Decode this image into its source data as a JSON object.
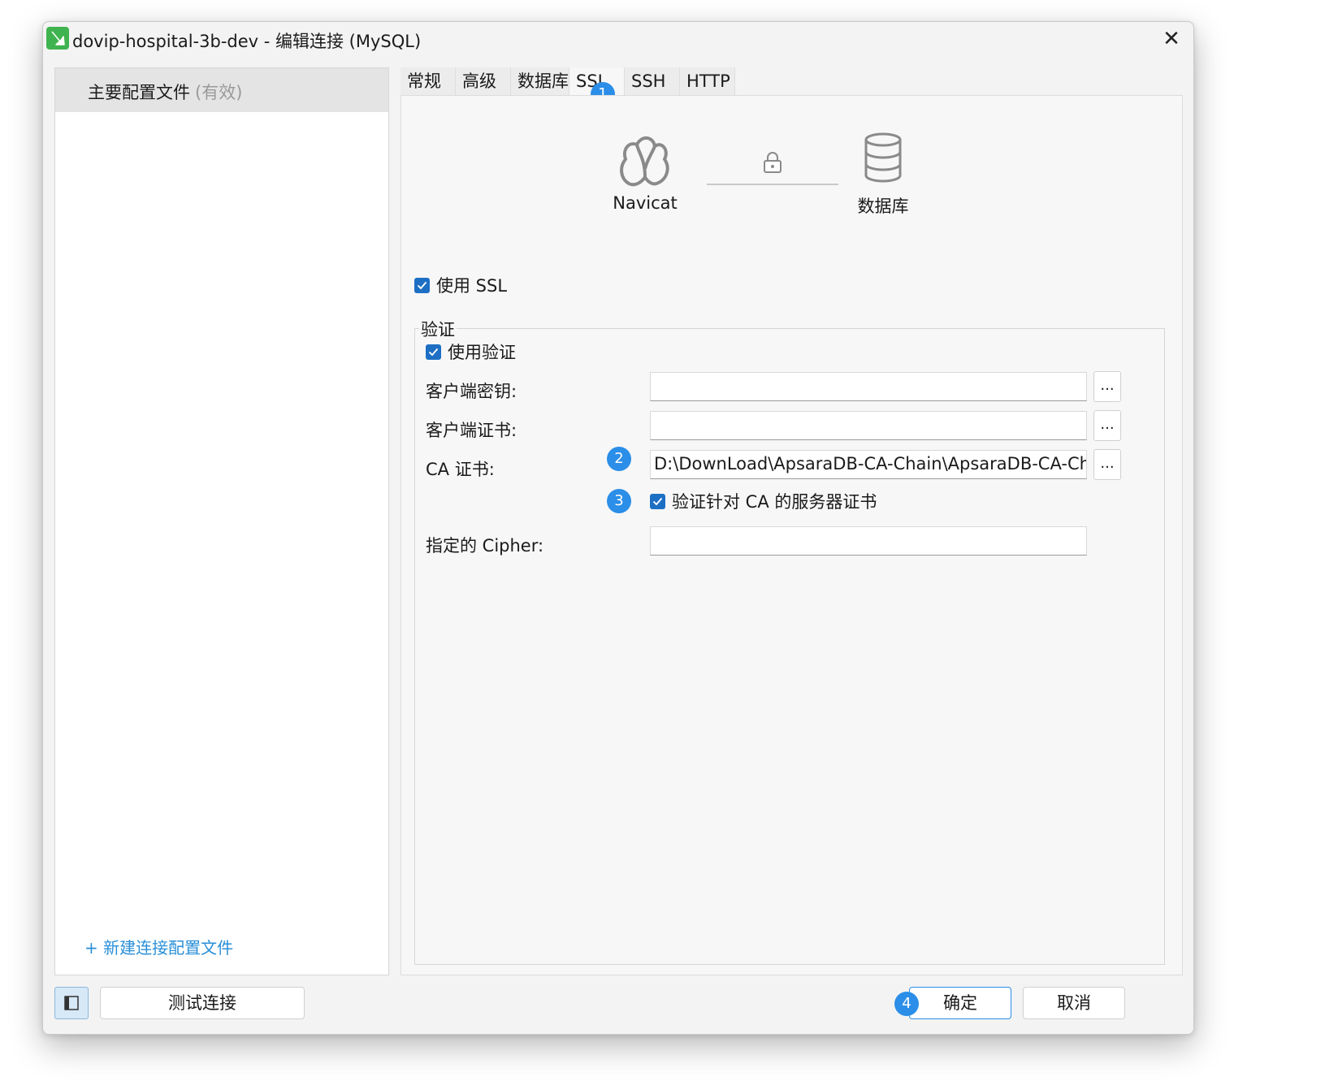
{
  "window": {
    "title": "dovip-hospital-3b-dev - 编辑连接 (MySQL)",
    "close_symbol": "✕"
  },
  "sidebar": {
    "profile_name": "主要配置文件",
    "profile_status": "(有效)",
    "new_profile_label": "+ 新建连接配置文件"
  },
  "tabs": [
    {
      "label": "常规"
    },
    {
      "label": "高级"
    },
    {
      "label": "数据库"
    },
    {
      "label": "SSL"
    },
    {
      "label": "SSH"
    },
    {
      "label": "HTTP"
    }
  ],
  "active_tab": "SSL",
  "diagram": {
    "client_label": "Navicat",
    "server_label": "数据库",
    "icons": [
      "navicat-logo-icon",
      "lock-icon",
      "database-icon"
    ]
  },
  "ssl": {
    "use_ssl_label": "使用 SSL",
    "use_ssl_checked": true,
    "auth_group_title": "验证",
    "use_auth_label": "使用验证",
    "use_auth_checked": true,
    "client_key_label": "客户端密钥:",
    "client_key_value": "",
    "client_cert_label": "客户端证书:",
    "client_cert_value": "",
    "ca_cert_label": "CA 证书:",
    "ca_cert_value": "D:\\DownLoad\\ApsaraDB-CA-Chain\\ApsaraDB-CA-Chain",
    "verify_ca_label": "验证针对 CA 的服务器证书",
    "verify_ca_checked": true,
    "cipher_label": "指定的 Cipher:",
    "cipher_value": "",
    "browse_label": "..."
  },
  "badges": {
    "b1": "1",
    "b2": "2",
    "b3": "3",
    "b4": "4"
  },
  "footer": {
    "test_button": "测试连接",
    "ok_button": "确定",
    "cancel_button": "取消"
  },
  "colors": {
    "accent": "#2b8ee8",
    "checkbox": "#1d6fc4",
    "link": "#2a8fd8",
    "app_icon": "#3fb34f"
  }
}
